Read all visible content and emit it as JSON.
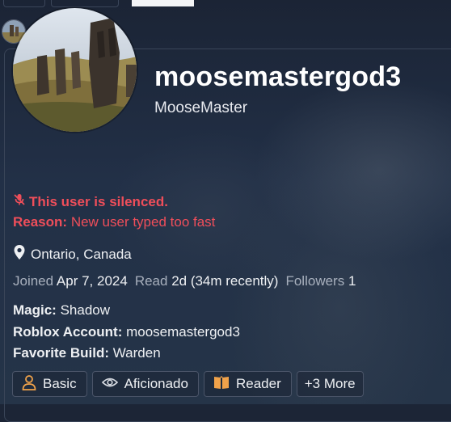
{
  "profile": {
    "username": "moosemastergod3",
    "display_name": "MooseMaster",
    "silenced_text": "This user is silenced.",
    "reason_label": "Reason:",
    "reason_text": "New user typed too fast",
    "location": "Ontario, Canada"
  },
  "stats": {
    "joined_label": "Joined",
    "joined_value": "Apr 7, 2024",
    "read_label": "Read",
    "read_value": "2d (34m recently)",
    "followers_label": "Followers",
    "followers_value": "1"
  },
  "fields": [
    {
      "label": "Magic:",
      "value": "Shadow"
    },
    {
      "label": "Roblox Account:",
      "value": "moosemastergod3"
    },
    {
      "label": "Favorite Build:",
      "value": "Warden"
    }
  ],
  "badges": [
    {
      "label": "Basic",
      "icon": "user-icon",
      "color": "#f0a24a"
    },
    {
      "label": "Aficionado",
      "icon": "eye-icon",
      "color": "#d7dbe2"
    },
    {
      "label": "Reader",
      "icon": "book-icon",
      "color": "#f0a24a"
    },
    {
      "label": "+3 More",
      "icon": "",
      "color": "#eef0f3"
    }
  ],
  "colors": {
    "alert": "#ef4e5a",
    "badge_orange": "#f0a24a",
    "background": "#1c2536"
  }
}
